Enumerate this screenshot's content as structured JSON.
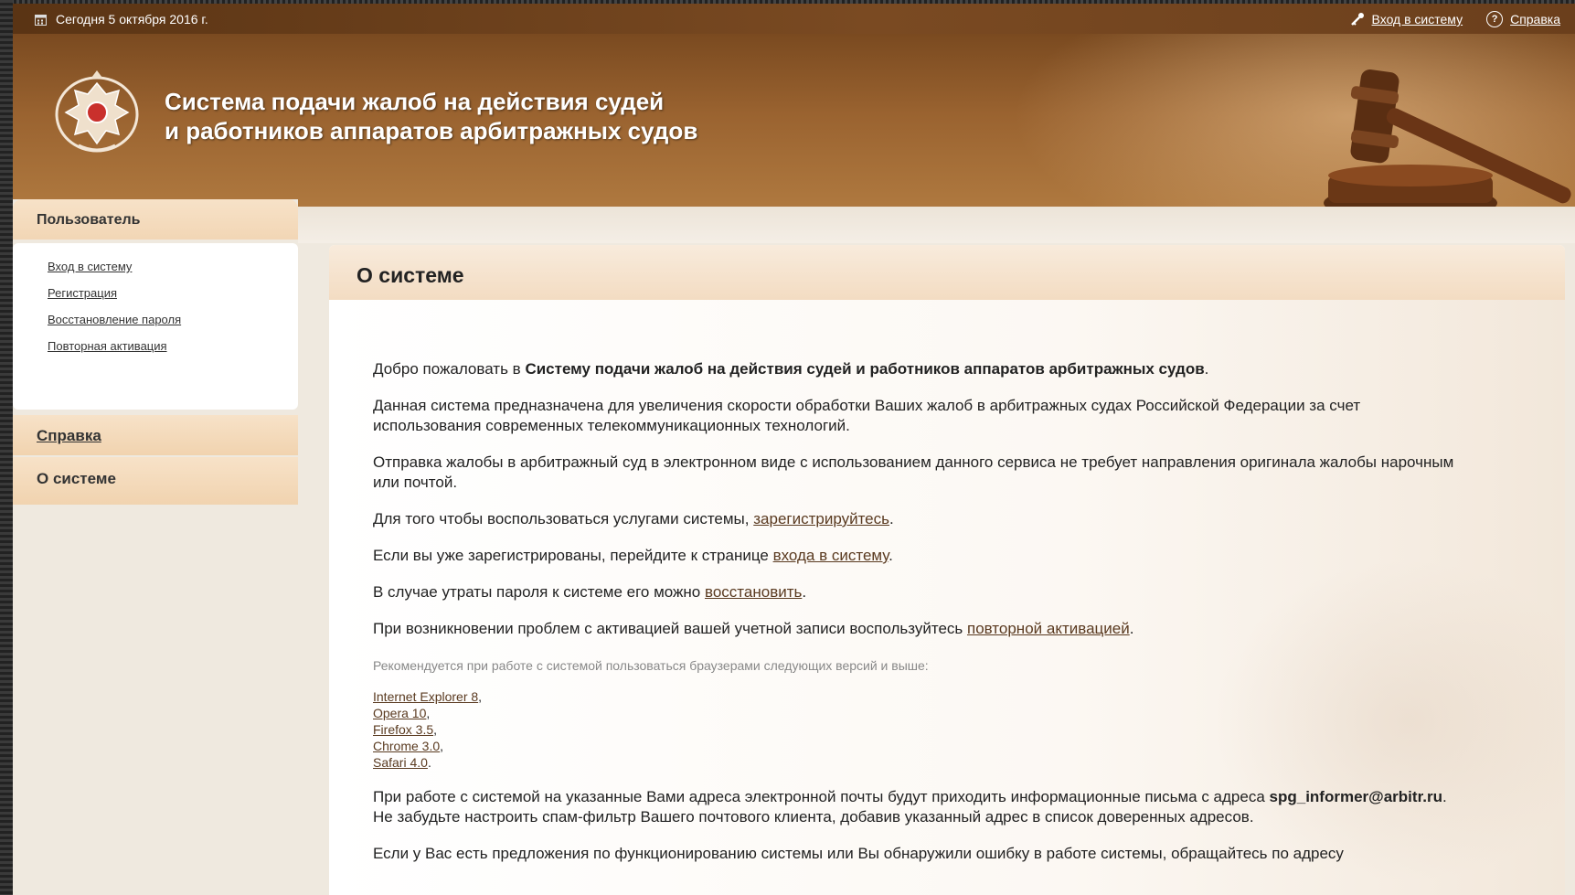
{
  "topbar": {
    "date": "Сегодня 5 октября 2016 г.",
    "login_link": "Вход в систему",
    "help_link": "Справка"
  },
  "header": {
    "title_line1": "Система подачи жалоб на действия судей",
    "title_line2": "и работников аппаратов арбитражных судов"
  },
  "sidebar": {
    "user_section": "Пользователь",
    "links": [
      "Вход в систему",
      "Регистрация",
      "Восстановление пароля",
      "Повторная активация"
    ],
    "help_section": "Справка",
    "about_section": "О системе"
  },
  "main": {
    "title": "О системе",
    "welcome_prefix": "Добро пожаловать в ",
    "welcome_bold": "Систему подачи жалоб на действия судей и работников аппаратов арбитражных судов",
    "welcome_suffix": ".",
    "para2": "Данная система предназначена для увеличения скорости обработки Ваших жалоб в арбитражных судах Российской Федерации за счет использования современных телекоммуникационных технологий.",
    "para3": "Отправка жалобы в арбитражный суд в электронном виде с использованием данного сервиса не требует направления оригинала жалобы нарочным или почтой.",
    "para4_prefix": "Для того чтобы воспользоваться услугами системы, ",
    "para4_link": "зарегистрируйтесь",
    "para5_prefix": "Если вы уже зарегистрированы, перейдите к странице ",
    "para5_link": "входа в систему",
    "para6_prefix": "В случае утраты пароля к системе его можно ",
    "para6_link": "восстановить",
    "para7_prefix": "При возникновении проблем с активацией вашей учетной записи воспользуйтесь ",
    "para7_link": "повторной активацией",
    "browsers_note": "Рекомендуется при работе с системой пользоваться браузерами следующих версий и выше:",
    "browsers": [
      "Internet Explorer 8",
      "Opera 10",
      "Firefox 3.5",
      "Chrome 3.0",
      "Safari 4.0"
    ],
    "email_prefix": "При работе с системой на указанные Вами адреса электронной почты будут приходить информационные письма с адреса ",
    "email_bold": "spg_informer@arbitr.ru",
    "email_suffix": ". Не забудьте настроить спам-фильтр Вашего почтового клиента, добавив указанный адрес в список доверенных адресов.",
    "last_para": "Если у Вас есть предложения по функционированию системы или Вы обнаружили ошибку в работе системы, обращайтесь по адресу"
  }
}
